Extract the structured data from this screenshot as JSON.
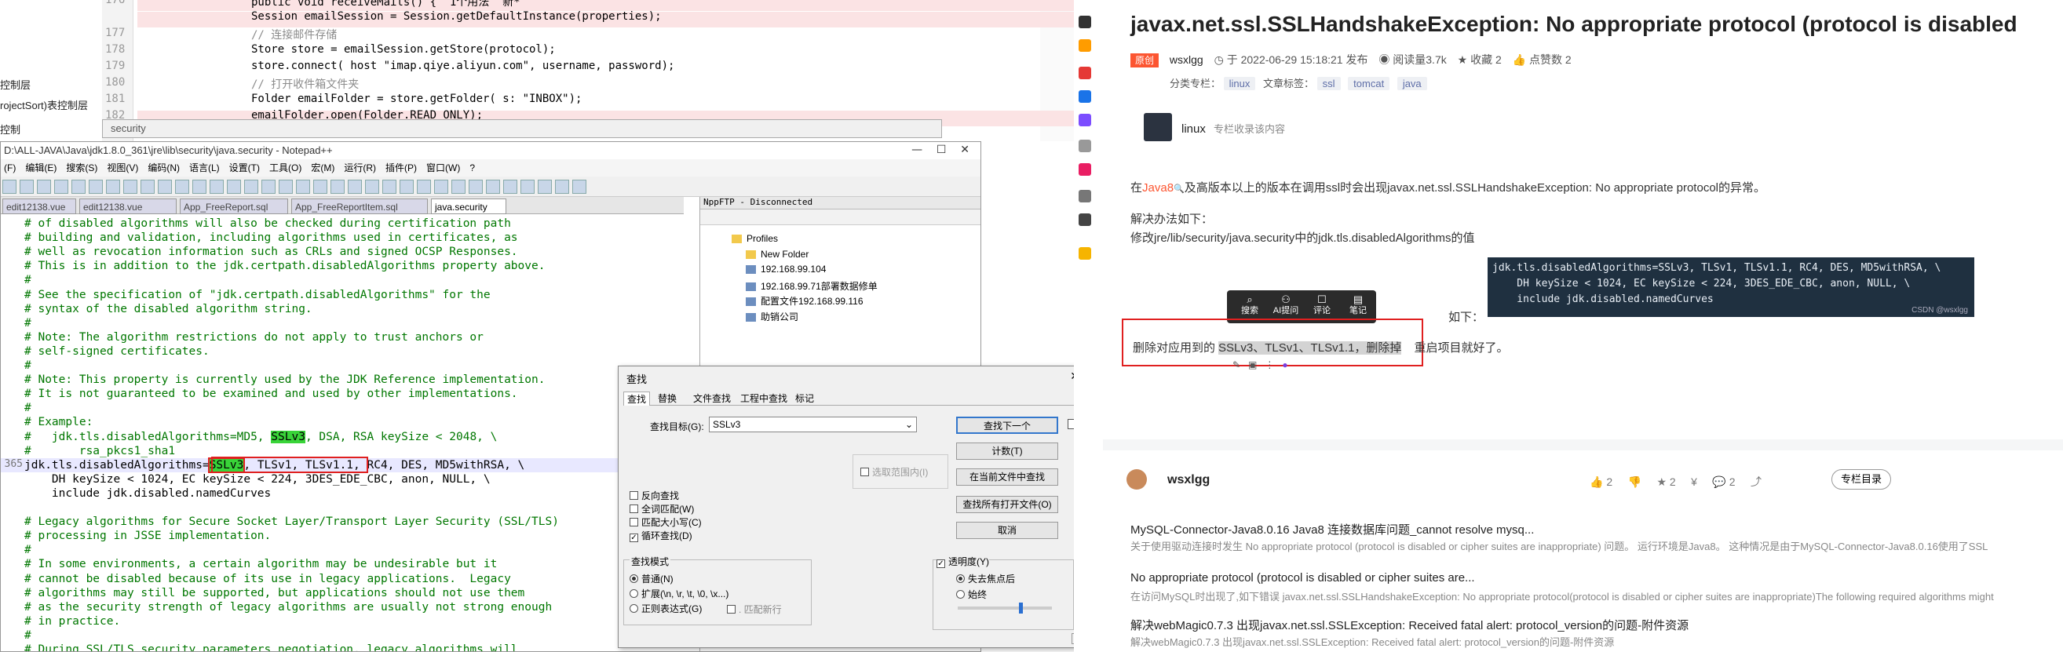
{
  "ide": {
    "lines": [
      {
        "n": "176",
        "code": "public void receiveMails() {  1个用法  新*",
        "bp": true
      },
      {
        "n": "",
        "code": "Session emailSession = Session.getDefaultInstance(properties);",
        "bp": true
      },
      {
        "n": "177",
        "code": "// 连接邮件存储",
        "bp": false
      },
      {
        "n": "178",
        "code": "Store store = emailSession.getStore(protocol);",
        "bp": false
      },
      {
        "n": "179",
        "code": "store.connect( host \"imap.qiye.aliyun.com\", username, password);",
        "bp": false
      },
      {
        "n": "180",
        "code": "// 打开收件箱文件夹",
        "bp": false
      },
      {
        "n": "181",
        "code": "Folder emailFolder = store.getFolder( s: \"INBOX\");",
        "bp": false
      },
      {
        "n": "182",
        "code": "emailFolder.open(Folder.READ_ONLY);",
        "bp": true
      }
    ],
    "left_labels": [
      "控制层",
      "rojectSort)表控制层",
      "控制"
    ],
    "path_hint": "security"
  },
  "npp": {
    "title": "D:\\ALL-JAVA\\Java\\jdk1.8.0_361\\jre\\lib\\security\\java.security - Notepad++",
    "menu": [
      "(F)",
      "编辑(E)",
      "搜索(S)",
      "视图(V)",
      "编码(N)",
      "语言(L)",
      "设置(T)",
      "工具(O)",
      "宏(M)",
      "运行(R)",
      "插件(P)",
      "窗口(W)",
      "?"
    ],
    "tabs": [
      "edit12138.vue",
      "edit12138.vue",
      "App_FreeReport.sql",
      "App_FreeReportItem.sql",
      "java.security"
    ],
    "active_line": "365",
    "lines": [
      "# of disabled algorithms will also be checked during certification path",
      "# building and validation, including algorithms used in certificates, as",
      "# well as revocation information such as CRLs and signed OCSP Responses.",
      "# This is in addition to the jdk.certpath.disabledAlgorithms property above.",
      "#",
      "# See the specification of \"jdk.certpath.disabledAlgorithms\" for the",
      "# syntax of the disabled algorithm string.",
      "#",
      "# Note: The algorithm restrictions do not apply to trust anchors or",
      "# self-signed certificates.",
      "#",
      "# Note: This property is currently used by the JDK Reference implementation.",
      "# It is not guaranteed to be examined and used by other implementations.",
      "#",
      "# Example:",
      "#   jdk.tls.disabledAlgorithms=MD5, SSLv3, DSA, RSA keySize < 2048, \\",
      "#       rsa_pkcs1_sha1",
      "jdk.tls.disabledAlgorithms=SSLv3, TLSv1, TLSv1.1, RC4, DES, MD5withRSA, \\",
      "    DH keySize < 1024, EC keySize < 224, 3DES_EDE_CBC, anon, NULL, \\",
      "    include jdk.disabled.namedCurves",
      "",
      "# Legacy algorithms for Secure Socket Layer/Transport Layer Security (SSL/TLS)",
      "# processing in JSSE implementation.",
      "#",
      "# In some environments, a certain algorithm may be undesirable but it",
      "# cannot be disabled because of its use in legacy applications.  Legacy",
      "# algorithms may still be supported, but applications should not use them",
      "# as the security strength of legacy algorithms are usually not strong enough",
      "# in practice.",
      "#",
      "# During SSL/TLS security parameters negotiation, legacy algorithms will"
    ],
    "ftp": {
      "title": "NppFTP - Disconnected",
      "items": [
        "Profiles",
        "New Folder",
        "192.168.99.104",
        "192.168.99.71部署数据修单",
        "配置文件192.168.99.116",
        "助销公司"
      ]
    }
  },
  "find": {
    "title": "查找",
    "tabs": [
      "查找",
      "替换",
      "文件查找",
      "工程中查找",
      "标记"
    ],
    "target_label": "查找目标(G):",
    "target_value": "SSLv3",
    "buttons": [
      "查找下一个",
      "计数(T)",
      "在当前文件中查找",
      "查找所有打开文件(O)",
      "取消"
    ],
    "in_selection": "选取范围内(I)",
    "options": [
      "反向查找",
      "全词匹配(W)",
      "匹配大小写(C)",
      "循环查找(D)"
    ],
    "options_checked": [
      false,
      false,
      false,
      true
    ],
    "mode_title": "查找模式",
    "modes": [
      "普通(N)",
      "扩展(\\n, \\r, \\t, \\0, \\x...)",
      "正则表达式(G)"
    ],
    "dot_newline": ". 匹配新行",
    "transparency": "透明度(Y)",
    "trans_opts": [
      "失去焦点后",
      "始终"
    ]
  },
  "web": {
    "title": "javax.net.ssl.SSLHandshakeException: No appropriate protocol (protocol is disabled",
    "badge": "原创",
    "author": "wsxlgg",
    "date": "于 2022-06-29 15:18:21 发布",
    "views": "阅读量3.7k",
    "fav": "收藏 2",
    "likes": "点赞数 2",
    "column_label": "分类专栏：",
    "column": "linux",
    "tags_label": "文章标签：",
    "tags": [
      "ssl",
      "tomcat",
      "java"
    ],
    "column_card": "linux",
    "column_card_sub": "专栏收录该内容",
    "p1_pre": "在",
    "p1_link": "Java8",
    "p1_post": "及高版本以上的版本在调用ssl时会出现javax.net.ssl.SSLHandshakeException: No appropriate protocol的异常。",
    "p2": "解决办法如下：",
    "p3": "修改jre/lib/security/java.security中的jdk.tls.disabledAlgorithms的值",
    "code_lines": [
      "jdk.tls.disabledAlgorithms=SSLv3, TLSv1, TLSv1.1, RC4, DES, MD5withRSA, \\",
      "    DH keySize < 1024, EC keySize < 224, 3DES_EDE_CBC, anon, NULL, \\",
      "    include jdk.disabled.namedCurves"
    ],
    "code_wm": "CSDN @wsxlgg",
    "rumo": "如下：",
    "popup": [
      "搜索",
      "AI提问",
      "评论",
      "笔记"
    ],
    "p4_pre": "删除对应用到的",
    "p4_sel": "SSLv3、TLSv1、TLSv1.1，删除掉",
    "p4_post": "重启项目就好了。",
    "footer_author": "wsxlgg",
    "footer_counts": [
      "2",
      "2",
      "2"
    ],
    "footer_btn": "专栏目录",
    "recs": [
      {
        "title": "MySQL-Connector-Java8.0.16 Java8 连接数据库问题_cannot resolve mysq...",
        "desc": "关于使用驱动连接时发生 No appropriate protocol (protocol is disabled or cipher suites are inappropriate) 问题。 运行环境是Java8。 这种情况是由于MySQL-Connector-Java8.0.16使用了SSL"
      },
      {
        "title": "No appropriate protocol (protocol is disabled or cipher suites are...",
        "desc": "在访问MySQL时出现了,如下错误 javax.net.ssl.SSLHandshakeException: No appropriate protocol(protocol is disabled or cipher suites are inappropriate)The following required algorithms might"
      },
      {
        "title": "解决webMagic0.7.3 出现javax.net.ssl.SSLException: Received fatal alert: protocol_version的问题-附件资源",
        "desc": "解决webMagic0.7.3 出现javax.net.ssl.SSLException: Received fatal alert: protocol_version的问题-附件资源"
      }
    ]
  }
}
